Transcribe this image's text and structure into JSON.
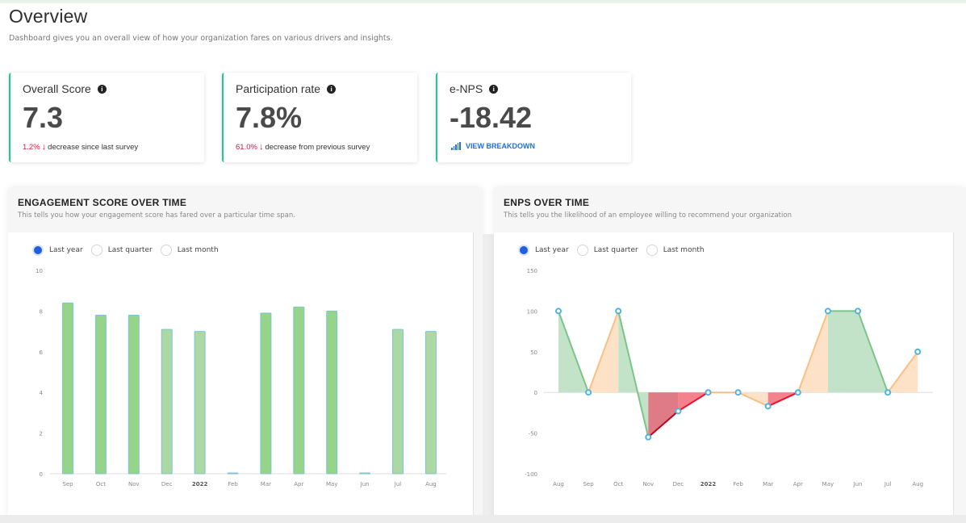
{
  "page": {
    "title": "Overview",
    "subtitle": "Dashboard gives you an overall view of how your organization fares on various drivers and insights."
  },
  "kpis": [
    {
      "label": "Overall Score",
      "info_icon": "info-icon",
      "value": "7.3",
      "delta_pct": "1.2%",
      "delta_arrow": "↓",
      "delta_text": "decrease since last survey"
    },
    {
      "label": "Participation rate",
      "info_icon": "info-icon",
      "value": "7.8%",
      "delta_pct": "61.0%",
      "delta_arrow": "↓",
      "delta_text": "decrease from previous survey"
    },
    {
      "label": "e-NPS",
      "info_icon": "info-icon",
      "value": "-18.42",
      "link_icon": "signal-bars-icon",
      "link_text": "VIEW BREAKDOWN"
    }
  ],
  "colors": {
    "accent": "#1fc98e",
    "negative": "#e0143c",
    "link": "#1f6fe5",
    "radio_selected": "#1f5fe0",
    "bar_dark": "#96d48a",
    "bar_light": "#acd8a4",
    "bar_stroke": "#7cc4d8",
    "point_stroke": "#4fb3e0"
  },
  "engagement_panel": {
    "title": "ENGAGEMENT SCORE OVER TIME",
    "subtitle": "This tells you how your engagement score has fared over a particular time span.",
    "radios": [
      {
        "label": "Last year",
        "selected": true
      },
      {
        "label": "Last quarter",
        "selected": false
      },
      {
        "label": "Last month",
        "selected": false
      }
    ]
  },
  "enps_panel": {
    "title": "ENPS OVER TIME",
    "subtitle": "This tells you the likelihood of an employee willing to recommend your organization",
    "radios": [
      {
        "label": "Last year",
        "selected": true
      },
      {
        "label": "Last quarter",
        "selected": false
      },
      {
        "label": "Last month",
        "selected": false
      }
    ]
  },
  "chart_data": [
    {
      "type": "bar",
      "title": "ENGAGEMENT SCORE OVER TIME",
      "xlabel": "",
      "ylabel": "",
      "categories": [
        "Sep",
        "Oct",
        "Nov",
        "Dec",
        "2022",
        "Feb",
        "Mar",
        "Apr",
        "May",
        "Jun",
        "Jul",
        "Aug"
      ],
      "bold_categories": [
        "2022"
      ],
      "values": [
        8.4,
        7.8,
        7.8,
        7.1,
        7.0,
        0,
        7.9,
        8.2,
        8.0,
        0,
        7.1,
        7.0
      ],
      "bar_shade": [
        "dark",
        "dark",
        "dark",
        "light",
        "light",
        "dark",
        "dark",
        "dark",
        "dark",
        "dark",
        "light",
        "light"
      ],
      "ylim": [
        0,
        10
      ],
      "yticks": [
        0,
        2,
        4,
        6,
        8,
        10
      ],
      "grid": false,
      "legend": "none"
    },
    {
      "type": "area",
      "title": "ENPS OVER TIME",
      "xlabel": "",
      "ylabel": "",
      "categories": [
        "Aug",
        "Sep",
        "Oct",
        "Nov",
        "Dec",
        "2022",
        "Feb",
        "Mar",
        "Apr",
        "May",
        "Jun",
        "Jul",
        "Aug"
      ],
      "bold_categories": [
        "2022"
      ],
      "values": [
        100,
        0,
        100,
        -55,
        -23,
        0,
        0,
        -17,
        0,
        100,
        100,
        0,
        50
      ],
      "segment_colors": [
        "#7cc48a",
        "#fbbf85",
        "#7cc48a",
        "#c0001d",
        "#e8132e",
        "#fbbf85",
        "#fbbf85",
        "#e8132e",
        "#fbbf85",
        "#7cc48a",
        "#7cc48a",
        "#fbbf85"
      ],
      "segment_fills": [
        "#c3e3c8",
        "#fde2c7",
        "#c3e3c8",
        "#de7b86",
        "#f3818e",
        "#fde2c7",
        "#fde2c7",
        "#f3818e",
        "#fde2c7",
        "#c3e3c8",
        "#c3e3c8",
        "#fde2c7"
      ],
      "ylim": [
        -100,
        150
      ],
      "yticks": [
        -100,
        -50,
        0,
        50,
        100,
        150
      ],
      "grid": false,
      "legend": "none"
    }
  ]
}
